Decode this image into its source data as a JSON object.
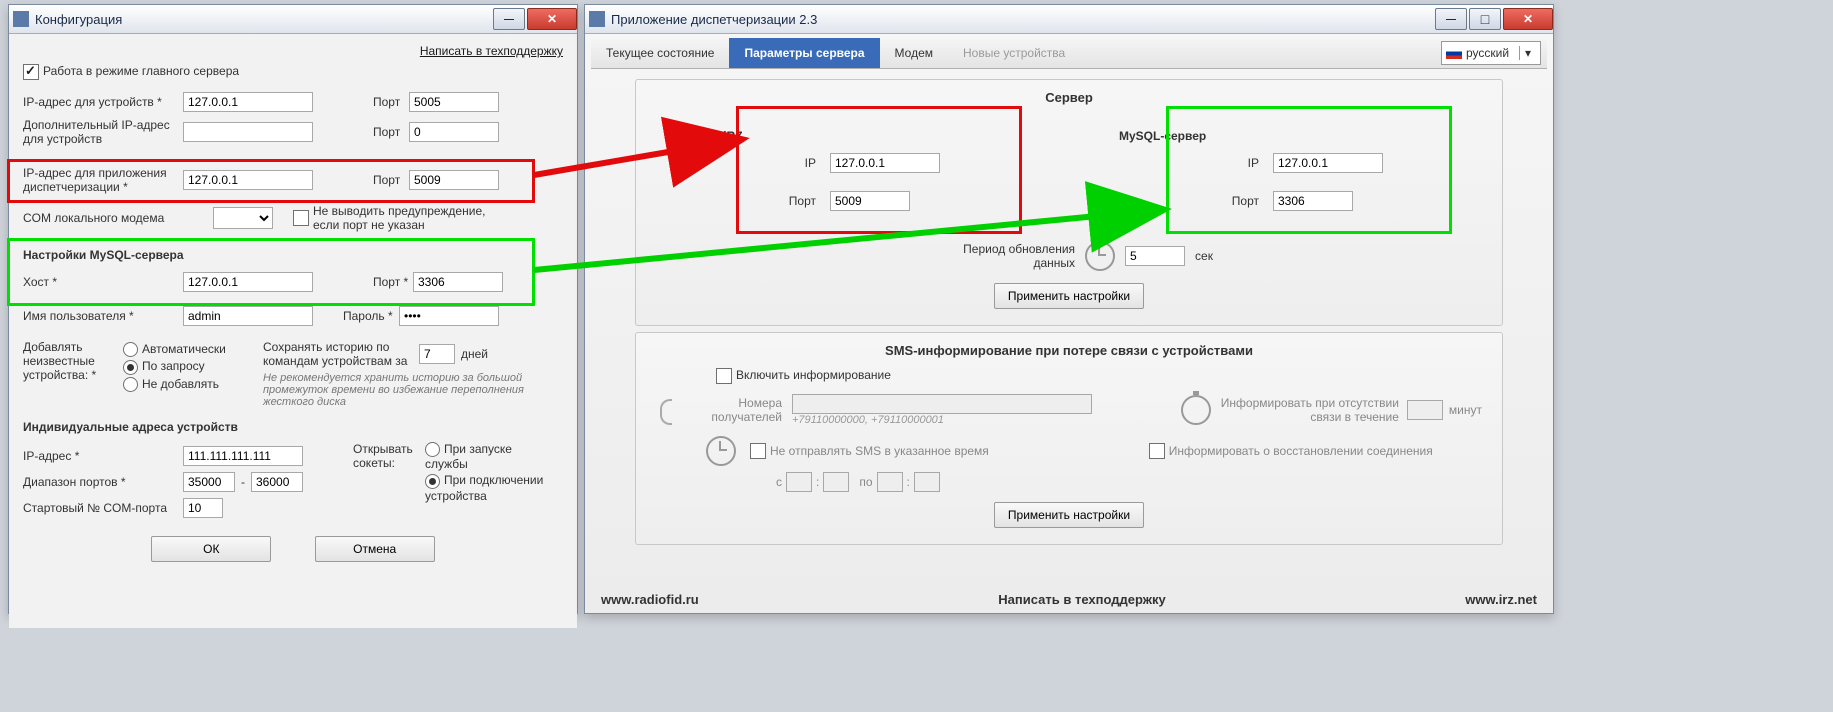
{
  "left_window": {
    "title": "Конфигурация",
    "support_link": "Написать в техподдержку",
    "main_server_mode": "Работа в режиме главного сервера",
    "ip_devices_label": "IP-адрес для устройств *",
    "ip_devices_value": "127.0.0.1",
    "port_label": "Порт",
    "port_devices_value": "5005",
    "extra_ip_label": "Дополнительный IP-адрес для устройств",
    "extra_ip_value": "",
    "extra_port_value": "0",
    "dispatch_ip_label": "IP-адрес для приложения диспетчеризации *",
    "dispatch_ip_value": "127.0.0.1",
    "dispatch_port_value": "5009",
    "com_modem_label": "COM локального модема",
    "no_warn_label": "Не выводить предупреждение, если порт не указан",
    "mysql_section": "Настройки MySQL-сервера",
    "host_label": "Хост *",
    "host_value": "127.0.0.1",
    "port_star_label": "Порт *",
    "mysql_port_value": "3306",
    "user_label": "Имя пользователя *",
    "user_value": "admin",
    "password_label": "Пароль *",
    "password_value": "••••",
    "add_unknown_label": "Добавлять неизвестные устройства: *",
    "auto_option": "Автоматически",
    "request_option": "По запросу",
    "no_add_option": "Не добавлять",
    "history_label": "Сохранять историю по командам устройствам за",
    "history_days": "7",
    "days_label": "дней",
    "history_note": "Не рекомендуется хранить историю за большой промежуток времени во избежание переполнения жесткого диска",
    "individual_addr": "Индивидуальные адреса устройств",
    "ip_address_label": "IP-адрес *",
    "ip_address_value": "111.111.111.111",
    "port_range_label": "Диапазон портов *",
    "port_range_from": "35000",
    "port_range_to": "36000",
    "dash": "-",
    "open_sockets_label": "Открывать сокеты:",
    "on_start_option": "При запуске службы",
    "on_connect_option": "При подключении устройства",
    "start_com_label": "Стартовый № COM-порта",
    "start_com_value": "10",
    "ok_btn": "ОК",
    "cancel_btn": "Отмена"
  },
  "right_window": {
    "title": "Приложение диспетчеризации 2.3",
    "tabs": {
      "current": "Текущее состояние",
      "params": "Параметры сервера",
      "modem": "Модем",
      "newdev": "Новые устройства"
    },
    "lang": "русский",
    "server_panel": "Сервер",
    "irz_server": "Сервер iRZ",
    "ip_label": "IP",
    "irz_ip_value": "127.0.0.1",
    "port_label": "Порт",
    "irz_port_value": "5009",
    "mysql_server": "MySQL-сервер",
    "mysql_ip_value": "127.0.0.1",
    "mysql_port_value": "3306",
    "refresh_label": "Период обновления данных",
    "refresh_value": "5",
    "refresh_unit": "сек",
    "apply_btn": "Применить настройки",
    "sms_panel": "SMS-информирование при потере связи с устройствами",
    "enable_inform": "Включить информирование",
    "recipients_label": "Номера получателей",
    "recipients_placeholder": "+79110000000, +79110000001",
    "inform_after_label": "Информировать при отсутствии связи в течение",
    "minutes_label": "минут",
    "no_sms_time_label": "Не отправлять SMS в указанное время",
    "from_label": "с",
    "to_label": "по",
    "colon": ":",
    "inform_restore": "Информировать о восстановлении соединения",
    "apply_btn2": "Применить настройки",
    "footer_left": "www.radiofid.ru",
    "footer_mid": "Написать в техподдержку",
    "footer_right": "www.irz.net"
  }
}
